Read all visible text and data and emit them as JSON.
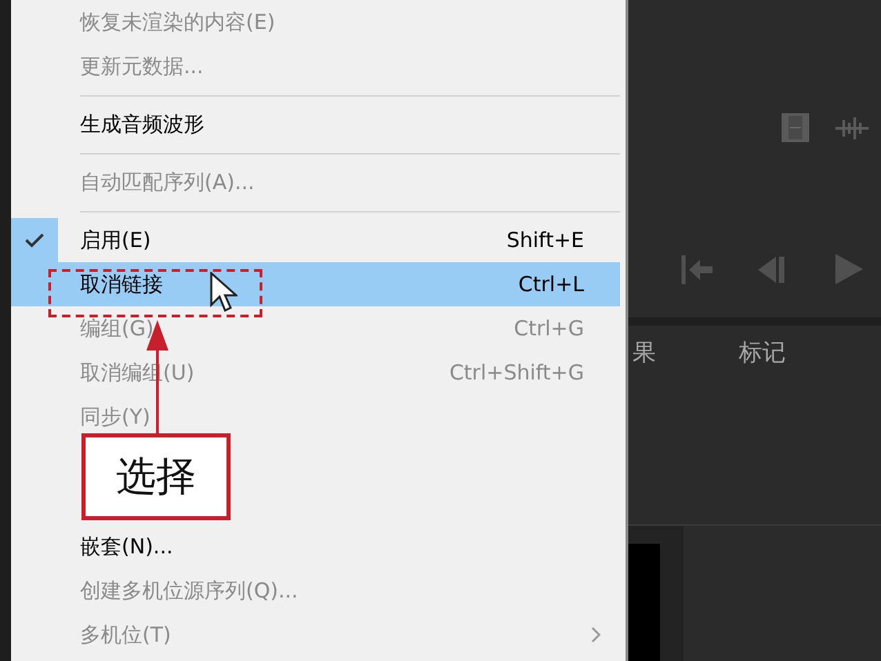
{
  "menu": {
    "items": [
      {
        "kind": "item",
        "label": "恢复未渲染的内容(E)",
        "disabled": true,
        "checked": false,
        "selected": false
      },
      {
        "kind": "item",
        "label": "更新元数据...",
        "disabled": true,
        "checked": false,
        "selected": false
      },
      {
        "kind": "separator"
      },
      {
        "kind": "item",
        "label": "生成音频波形",
        "disabled": false,
        "checked": false,
        "selected": false
      },
      {
        "kind": "separator"
      },
      {
        "kind": "item",
        "label": "自动匹配序列(A)...",
        "disabled": true,
        "checked": false,
        "selected": false
      },
      {
        "kind": "separator"
      },
      {
        "kind": "item",
        "label": "启用(E)",
        "shortcut": "Shift+E",
        "disabled": false,
        "checked": true,
        "selected": false
      },
      {
        "kind": "item",
        "label": "取消链接",
        "shortcut": "Ctrl+L",
        "disabled": false,
        "checked": false,
        "selected": true
      },
      {
        "kind": "item",
        "label": "编组(G)",
        "shortcut": "Ctrl+G",
        "disabled": true,
        "checked": false,
        "selected": false
      },
      {
        "kind": "item",
        "label": "取消编组(U)",
        "shortcut": "Ctrl+Shift+G",
        "disabled": true,
        "checked": false,
        "selected": false
      },
      {
        "kind": "item",
        "label": "同步(Y)",
        "disabled": true,
        "checked": false,
        "selected": false
      },
      {
        "kind": "spacer"
      },
      {
        "kind": "item",
        "label": "嵌套(N)...",
        "disabled": false,
        "checked": false,
        "selected": false
      },
      {
        "kind": "item",
        "label": "创建多机位源序列(Q)...",
        "disabled": true,
        "checked": false,
        "selected": false
      },
      {
        "kind": "item",
        "label": "多机位(T)",
        "disabled": true,
        "checked": false,
        "selected": false,
        "submenu": true
      }
    ]
  },
  "panel": {
    "tabs": [
      "果",
      "标记"
    ]
  },
  "callout": {
    "label": "选择"
  }
}
